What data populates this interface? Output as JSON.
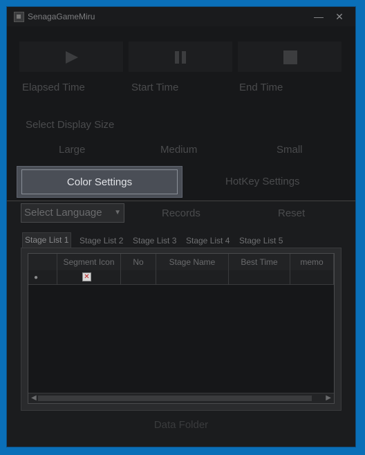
{
  "window": {
    "title": "SenagaGameMiru"
  },
  "titlebar": {
    "minimize": "—",
    "close": "✕"
  },
  "controls": {
    "play_icon": "play-icon",
    "pause_icon": "pause-icon",
    "stop_icon": "stop-icon"
  },
  "stats": {
    "elapsed": "Elapsed Time",
    "start": "Start Time",
    "end": "End Time"
  },
  "display_size": {
    "label": "Select Display Size",
    "options": [
      "Large",
      "Medium",
      "Small"
    ]
  },
  "settings": {
    "color": "Color Settings",
    "hotkey": "HotKey Settings"
  },
  "language": {
    "selected": "Select Language"
  },
  "actions": {
    "records": "Records",
    "reset": "Reset"
  },
  "tabs": [
    "Stage List 1",
    "Stage List 2",
    "Stage List 3",
    "Stage List 4",
    "Stage List 5"
  ],
  "grid": {
    "columns": [
      "Segment Icon",
      "No",
      "Stage Name",
      "Best Time",
      "memo"
    ],
    "row_marker": "●"
  },
  "footer": {
    "data_folder": "Data Folder"
  },
  "colors": {
    "accent": "#0a6fb8",
    "background": "#1c1d1f",
    "highlight": "#4a4e56"
  }
}
